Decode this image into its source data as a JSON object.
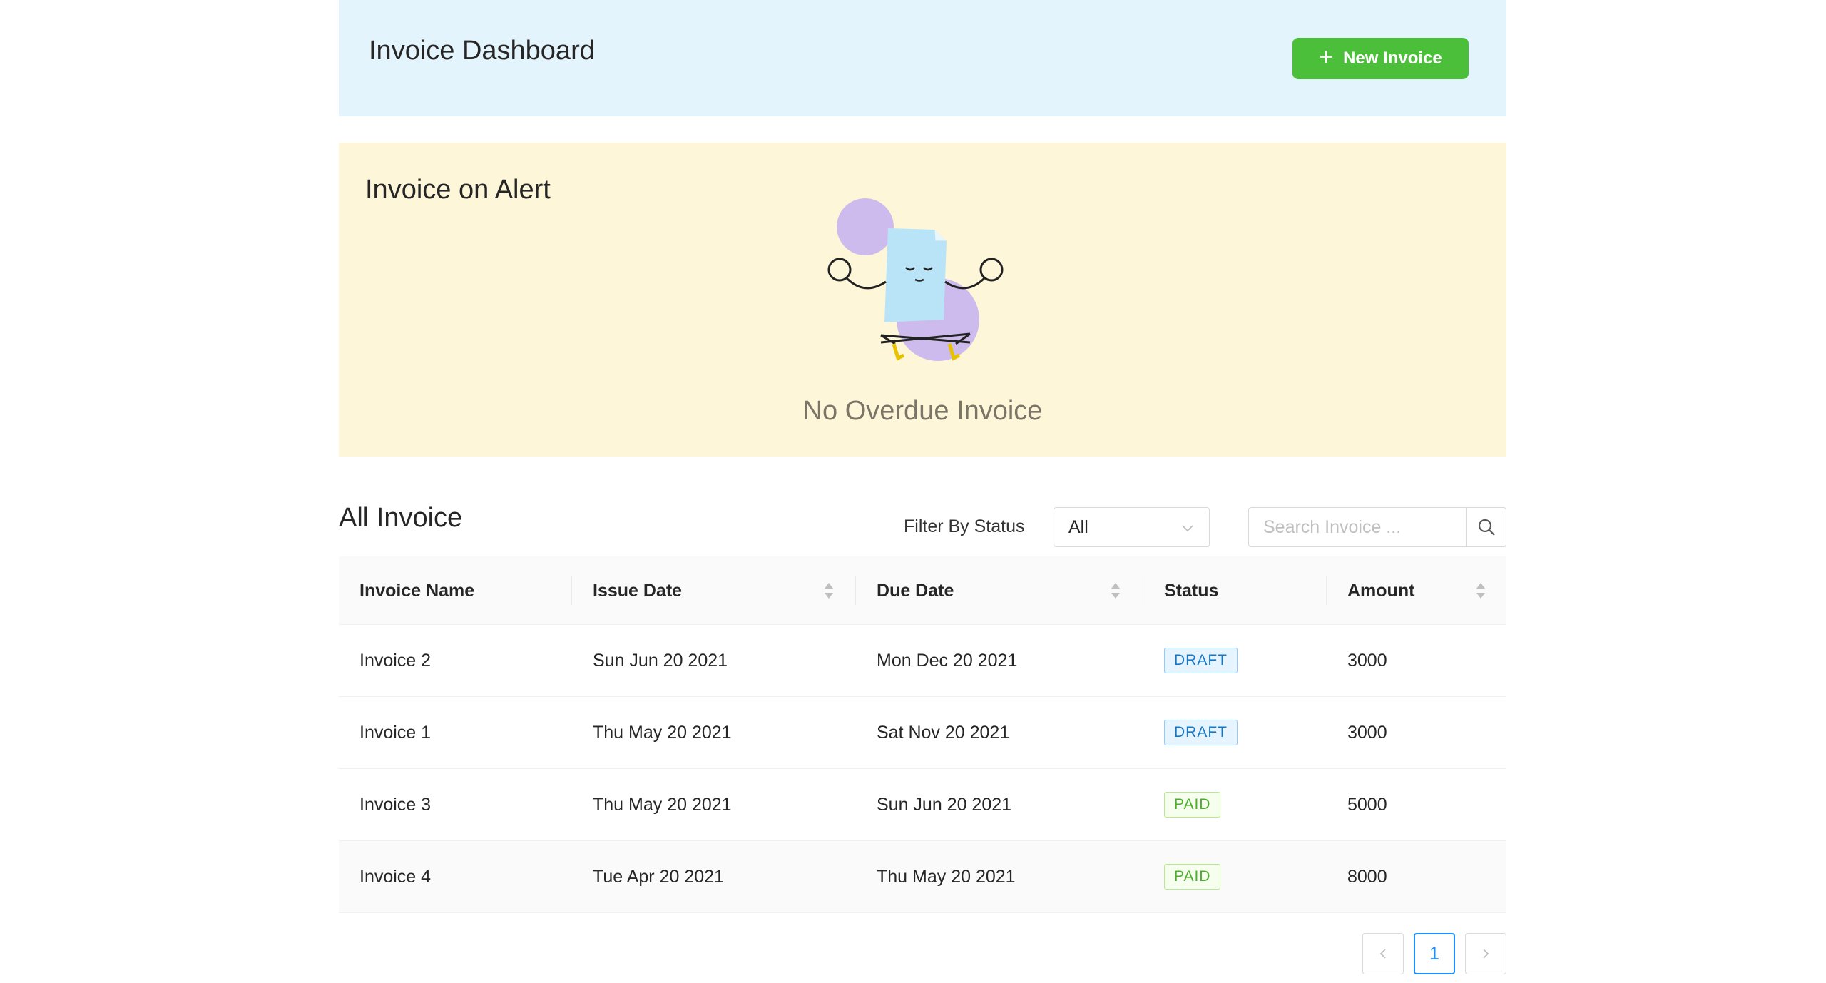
{
  "header": {
    "title": "Invoice Dashboard",
    "new_button_label": "New Invoice",
    "new_button_icon": "plus-icon",
    "background": "#e4f4fc",
    "button_color": "#4cbf3a"
  },
  "alert": {
    "title": "Invoice on Alert",
    "empty_text": "No Overdue Invoice",
    "background": "#fdf6d8"
  },
  "invoices": {
    "title": "All Invoice",
    "filter_label": "Filter By Status",
    "filter_value": "All",
    "search_placeholder": "Search Invoice ...",
    "columns": [
      "Invoice Name",
      "Issue Date",
      "Due Date",
      "Status",
      "Amount"
    ],
    "rows": [
      {
        "name": "Invoice 2",
        "issue": "Sun Jun 20 2021",
        "due": "Mon Dec 20 2021",
        "status": "DRAFT",
        "amount": "3000"
      },
      {
        "name": "Invoice 1",
        "issue": "Thu May 20 2021",
        "due": "Sat Nov 20 2021",
        "status": "DRAFT",
        "amount": "3000"
      },
      {
        "name": "Invoice 3",
        "issue": "Thu May 20 2021",
        "due": "Sun Jun 20 2021",
        "status": "PAID",
        "amount": "5000"
      },
      {
        "name": "Invoice 4",
        "issue": "Tue Apr 20 2021",
        "due": "Thu May 20 2021",
        "status": "PAID",
        "amount": "8000"
      }
    ]
  },
  "pagination": {
    "current_page": "1"
  }
}
